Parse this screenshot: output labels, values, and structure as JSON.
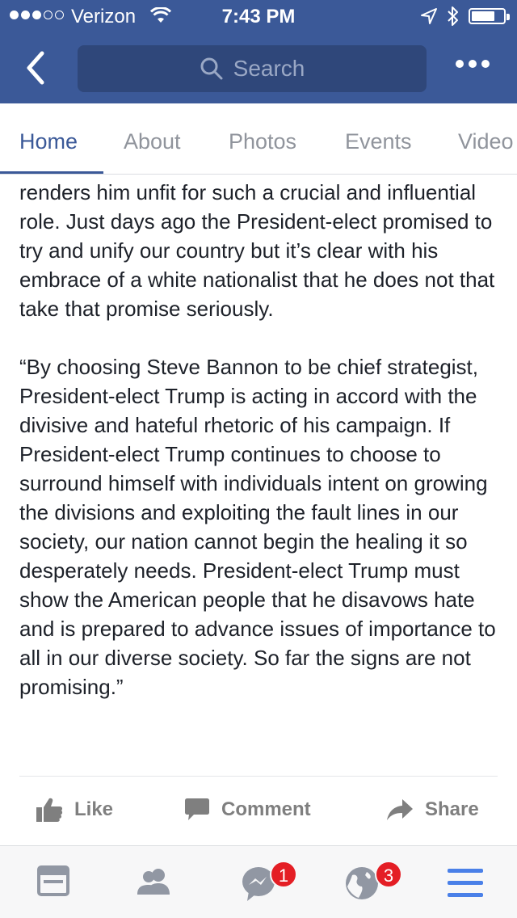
{
  "status_bar": {
    "carrier": "Verizon",
    "time": "7:43 PM"
  },
  "header": {
    "search_placeholder": "Search"
  },
  "tabs": [
    {
      "label": "Home",
      "active": true
    },
    {
      "label": "About"
    },
    {
      "label": "Photos"
    },
    {
      "label": "Events"
    },
    {
      "label": "Video"
    }
  ],
  "post": {
    "paragraph1": "renders him unfit for such a crucial and influential role.  Just days ago the President-elect promised to try and unify our country but it’s clear with his embrace of a white nationalist that he does not that take that promise seriously.",
    "paragraph2": "“By choosing Steve Bannon to be chief strategist, President-elect Trump is acting in accord with the divisive and hateful rhetoric of his campaign.  If President-elect Trump continues to choose to surround himself with individuals intent on growing the divisions and exploiting the fault lines in our society, our nation cannot begin the healing it so desperately needs.  President-elect Trump must show the American people that he disavows hate and is prepared to advance issues of importance to all in our diverse society. So far the signs are not promising.”"
  },
  "actions": {
    "like": "Like",
    "comment": "Comment",
    "share": "Share"
  },
  "bottom_bar": {
    "messenger_badge": "1",
    "notifications_badge": "3"
  },
  "colors": {
    "brand": "#3b5998",
    "badge": "#e41e25"
  }
}
